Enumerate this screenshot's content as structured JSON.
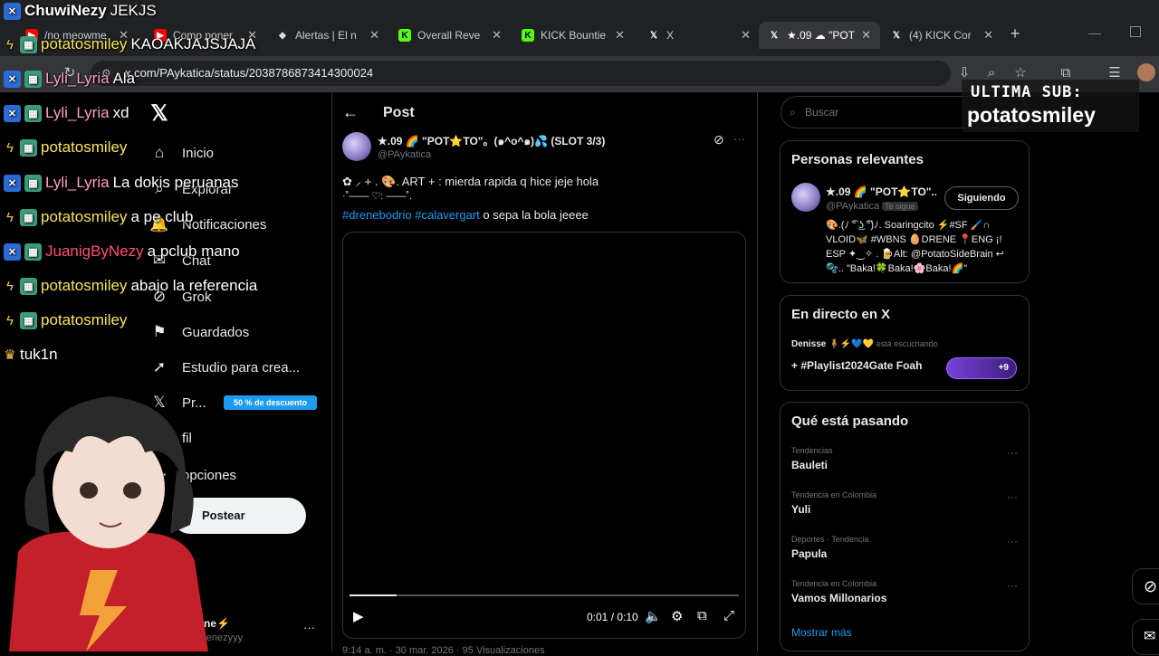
{
  "browser": {
    "tabs": [
      {
        "label": "/no meowme",
        "icon": "youtube-icon"
      },
      {
        "label": "Como poner",
        "icon": "youtube-icon"
      },
      {
        "label": "Alertas | El n",
        "icon": "alert-icon"
      },
      {
        "label": "Overall Reve",
        "icon": "kick-icon"
      },
      {
        "label": "KICK Bountie",
        "icon": "kick-icon"
      },
      {
        "label": "X",
        "icon": "x-icon"
      },
      {
        "label": "★.09 ☁ \"POT",
        "icon": "x-icon"
      },
      {
        "label": "(4) KICK Cor",
        "icon": "x-icon"
      }
    ],
    "url": "x.com/PAykatica/status/2038786873414300024"
  },
  "x_nav": {
    "items": [
      {
        "label": "Inicio",
        "icon": "home-icon"
      },
      {
        "label": "Explorar",
        "icon": "search-icon"
      },
      {
        "label": "Notificaciones",
        "icon": "bell-icon"
      },
      {
        "label": "Chat",
        "icon": "chat-icon"
      },
      {
        "label": "Grok",
        "icon": "grok-icon"
      },
      {
        "label": "Guardados",
        "icon": "bookmark-icon"
      },
      {
        "label": "Estudio para crea...",
        "icon": "rocket-icon"
      },
      {
        "label": "Pr...",
        "icon": "premium-icon"
      },
      {
        "label": "fil",
        "icon": "profile-icon"
      },
      {
        "label": "opciones",
        "icon": "more-icon"
      }
    ],
    "promo": "50 % de descuento",
    "post_button": "Postear",
    "account_name": "Drene⚡",
    "account_handle": "@Drenezyyy"
  },
  "post": {
    "header": "Post",
    "author_name": "★.09 🌈 \"POT⭐TO\"。(๑^o^๑)💦 (SLOT 3/3)",
    "author_handle": "@PAykatica",
    "line1": "✿ ⸝ + . 🎨. ART + : mierda rapida q hice jeje hola",
    "line2": "·˚—— ♡: ——˚.",
    "hashtag1": "#drenebodrio",
    "hashtag2": "#calavergart",
    "tail_text": "o sepa la bola jeeee",
    "video_time": "0:01 / 0:10",
    "video_progress": 0.12,
    "meta_partial": "9:14 a. m. · 30 mar. 2026 · 95 Visualizaciones"
  },
  "right": {
    "search_placeholder": "Buscar",
    "relevant": {
      "title": "Personas relevantes",
      "name": "★.09 🌈 \"POT⭐TO\"...",
      "handle": "@PAykatica",
      "follows_you": "Te sigue",
      "follow_button": "Siguiendo",
      "bio_line1": "🎨.(ﾉ ͡° ͜ʖ ͡°)ﾉ. Soaringcito ⚡#SF 🖌️∩",
      "bio_line2": "VLOID🦋 #WBNS 🥚DRENE 📍ENG ¡!",
      "bio_line3": "ESP ✦‿✧ . 🍺Alt: @PotatoSideBrain ↩",
      "bio_line4": "🫧.. \"Baka!🍀Baka!🌸Baka!🌈\""
    },
    "live": {
      "title": "En directo en X",
      "host": "Denisse 🧍⚡💙💛",
      "listening": "está escuchando",
      "space": "+ #Playlist2024Gate Foah",
      "count": "+9"
    },
    "trending": {
      "title": "Qué está pasando",
      "items": [
        {
          "meta": "Tendencias",
          "name": "Bauleti"
        },
        {
          "meta": "Tendencia en Colombia",
          "name": "Yuli"
        },
        {
          "meta": "Deportes · Tendencia",
          "name": "Papula"
        },
        {
          "meta": "Tendencia en Colombia",
          "name": "Vamos Millonarios"
        }
      ],
      "show_more": "Mostrar más"
    }
  },
  "stream": {
    "top_user": "ChuwiNezy",
    "top_msg": "JEKJS",
    "chat": [
      {
        "badges": [
          "bolt",
          "green"
        ],
        "user": "potatosmiley",
        "msg": "KAOAKJAJSJAJA",
        "color": "yellow"
      },
      {
        "badges": [
          "blue",
          "green"
        ],
        "user": "Lyli_Lyria",
        "msg": "Ala",
        "color": "pink"
      },
      {
        "badges": [
          "blue",
          "green"
        ],
        "user": "Lyli_Lyria",
        "msg": "xd",
        "color": "pink"
      },
      {
        "badges": [
          "bolt",
          "green"
        ],
        "user": "potatosmiley",
        "msg": "",
        "color": "yellow"
      },
      {
        "badges": [
          "blue",
          "green"
        ],
        "user": "Lyli_Lyria",
        "msg": "La dokis peruanas",
        "color": "pink"
      },
      {
        "badges": [
          "bolt",
          "green"
        ],
        "user": "potatosmiley",
        "msg": "a pe club",
        "color": "yellow"
      },
      {
        "badges": [
          "blue",
          "green"
        ],
        "user": "JuanigByNezy",
        "msg": "a pclub mano",
        "color": "red"
      },
      {
        "badges": [
          "bolt",
          "green"
        ],
        "user": "potatosmiley",
        "msg": "abajo la referencia",
        "color": "yellow"
      },
      {
        "badges": [
          "bolt",
          "green"
        ],
        "user": "potatosmiley",
        "msg": "",
        "color": "yellow"
      },
      {
        "badges": [
          "crown"
        ],
        "user": "tuk1n",
        "msg": "",
        "color": "white"
      }
    ],
    "sub_title": "ULTIMA SUB:",
    "sub_name": "potatosmiley"
  }
}
